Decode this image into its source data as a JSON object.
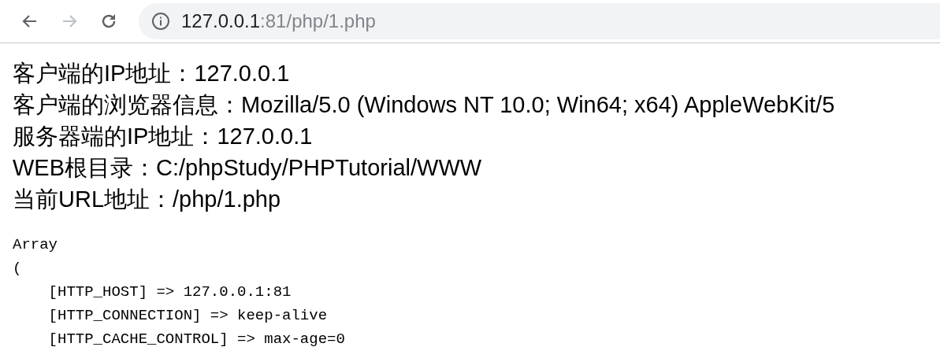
{
  "toolbar": {
    "back": {
      "disabled": false
    },
    "forward": {
      "disabled": true
    },
    "address": {
      "host": "127.0.0.1",
      "rest": ":81/php/1.php"
    }
  },
  "info_lines": [
    "客户端的IP地址：127.0.0.1",
    "客户端的浏览器信息：Mozilla/5.0 (Windows NT 10.0; Win64; x64) AppleWebKit/5",
    "服务器端的IP地址：127.0.0.1",
    "WEB根目录：C:/phpStudy/PHPTutorial/WWW",
    "当前URL地址：/php/1.php"
  ],
  "dump_lines": [
    "Array",
    "(",
    "    [HTTP_HOST] => 127.0.0.1:81",
    "    [HTTP_CONNECTION] => keep-alive",
    "    [HTTP_CACHE_CONTROL] => max-age=0"
  ]
}
